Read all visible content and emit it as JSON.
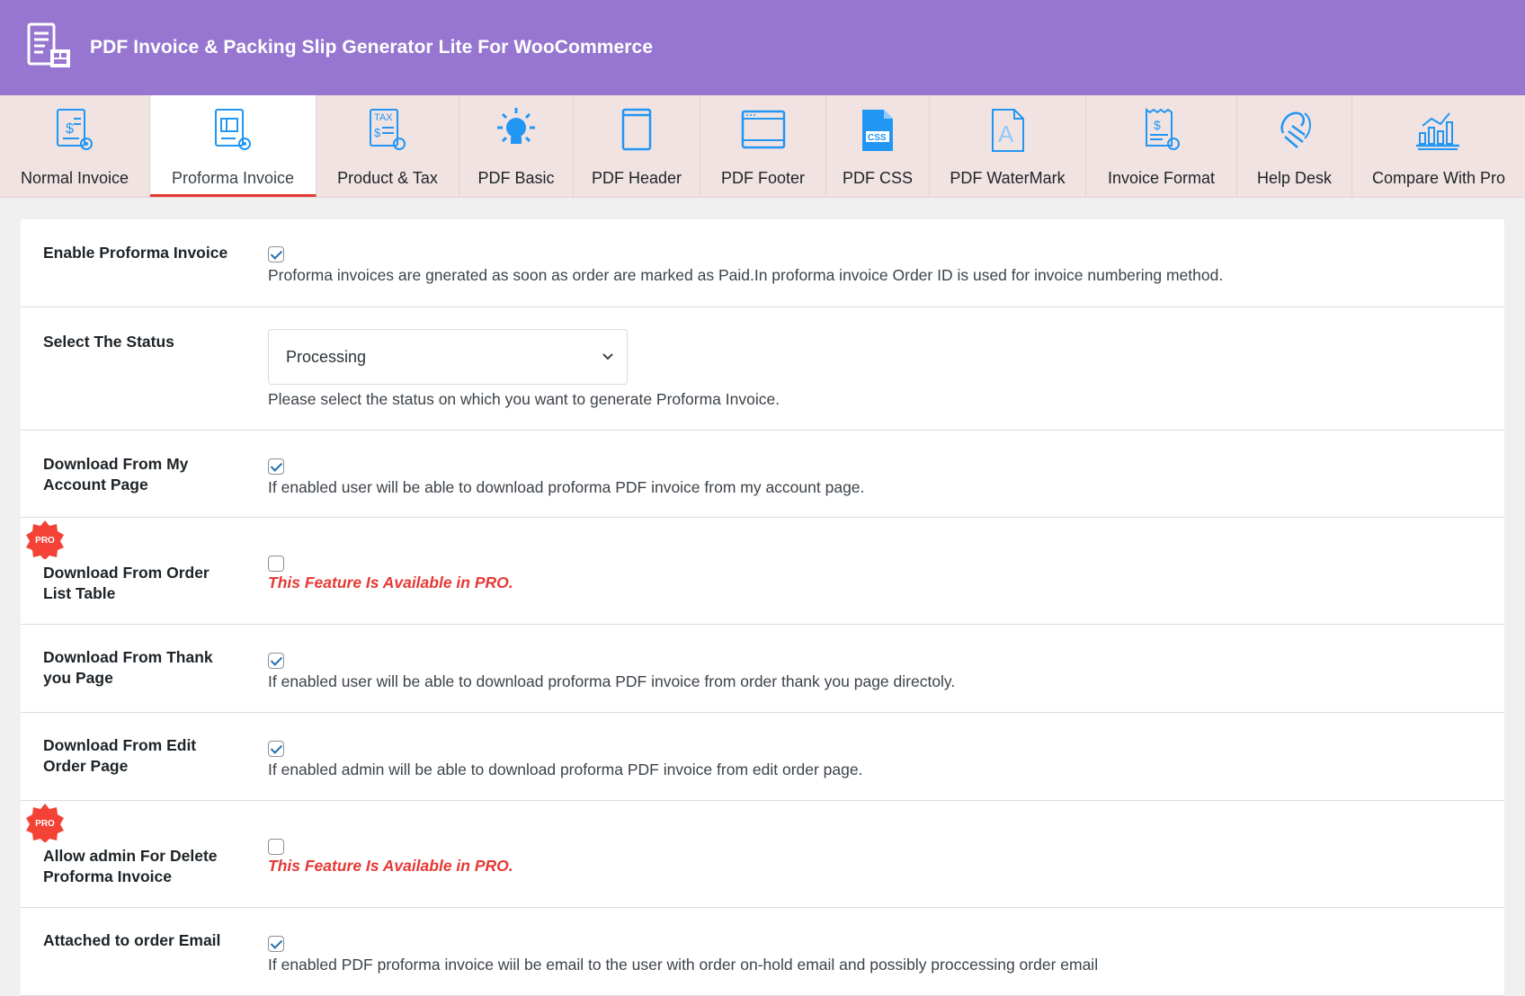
{
  "header": {
    "title": "PDF Invoice & Packing Slip Generator Lite For WooCommerce"
  },
  "tabs": [
    {
      "label": "Normal Invoice",
      "icon": "normal-invoice-icon"
    },
    {
      "label": "Proforma Invoice",
      "icon": "proforma-invoice-icon",
      "active": true
    },
    {
      "label": "Product & Tax",
      "icon": "product-tax-icon"
    },
    {
      "label": "PDF Basic",
      "icon": "lightbulb-icon"
    },
    {
      "label": "PDF Header",
      "icon": "pdf-header-icon"
    },
    {
      "label": "PDF Footer",
      "icon": "pdf-footer-icon"
    },
    {
      "label": "PDF CSS",
      "icon": "pdf-css-icon",
      "icon_text": "CSS"
    },
    {
      "label": "PDF WaterMark",
      "icon": "watermark-icon",
      "icon_text": "A"
    },
    {
      "label": "Invoice Format",
      "icon": "invoice-format-icon"
    },
    {
      "label": "Help Desk",
      "icon": "help-desk-icon"
    },
    {
      "label": "Compare With Pro",
      "icon": "compare-chart-icon"
    }
  ],
  "tax_icon_text": "TAX",
  "pro_badge_text": "PRO",
  "settings": {
    "enable_proforma": {
      "label": "Enable Proforma Invoice",
      "checked": true,
      "desc": "Proforma invoices are gnerated as soon as order are marked as Paid.In proforma invoice Order ID is used for invoice numbering method."
    },
    "select_status": {
      "label": "Select The Status",
      "value": "Processing",
      "desc": "Please select the status on which you want to generate Proforma Invoice."
    },
    "download_my_account": {
      "label": "Download From My Account Page",
      "checked": true,
      "desc": "If enabled user will be able to download proforma PDF invoice from my account page."
    },
    "download_order_list": {
      "label": "Download From Order List Table",
      "checked": false,
      "pro_msg": "This Feature Is Available in PRO."
    },
    "download_thank_you": {
      "label": "Download From Thank you Page",
      "checked": true,
      "desc": "If enabled user will be able to download proforma PDF invoice from order thank you page directoly."
    },
    "download_edit_order": {
      "label": "Download From Edit Order Page",
      "checked": true,
      "desc": "If enabled admin will be able to download proforma PDF invoice from edit order page."
    },
    "allow_admin_delete": {
      "label": "Allow admin For Delete Proforma Invoice",
      "checked": false,
      "pro_msg": "This Feature Is Available in PRO."
    },
    "attach_email": {
      "label": "Attached to order Email",
      "checked": true,
      "desc": "If enabled PDF proforma invoice wiil be email to the user with order on-hold email and possibly proccessing order email"
    }
  },
  "colors": {
    "header_bg": "#9676d0",
    "tabs_bg": "#f2e3e3",
    "icon_blue": "#2196f3",
    "pro_red": "#e53935"
  }
}
